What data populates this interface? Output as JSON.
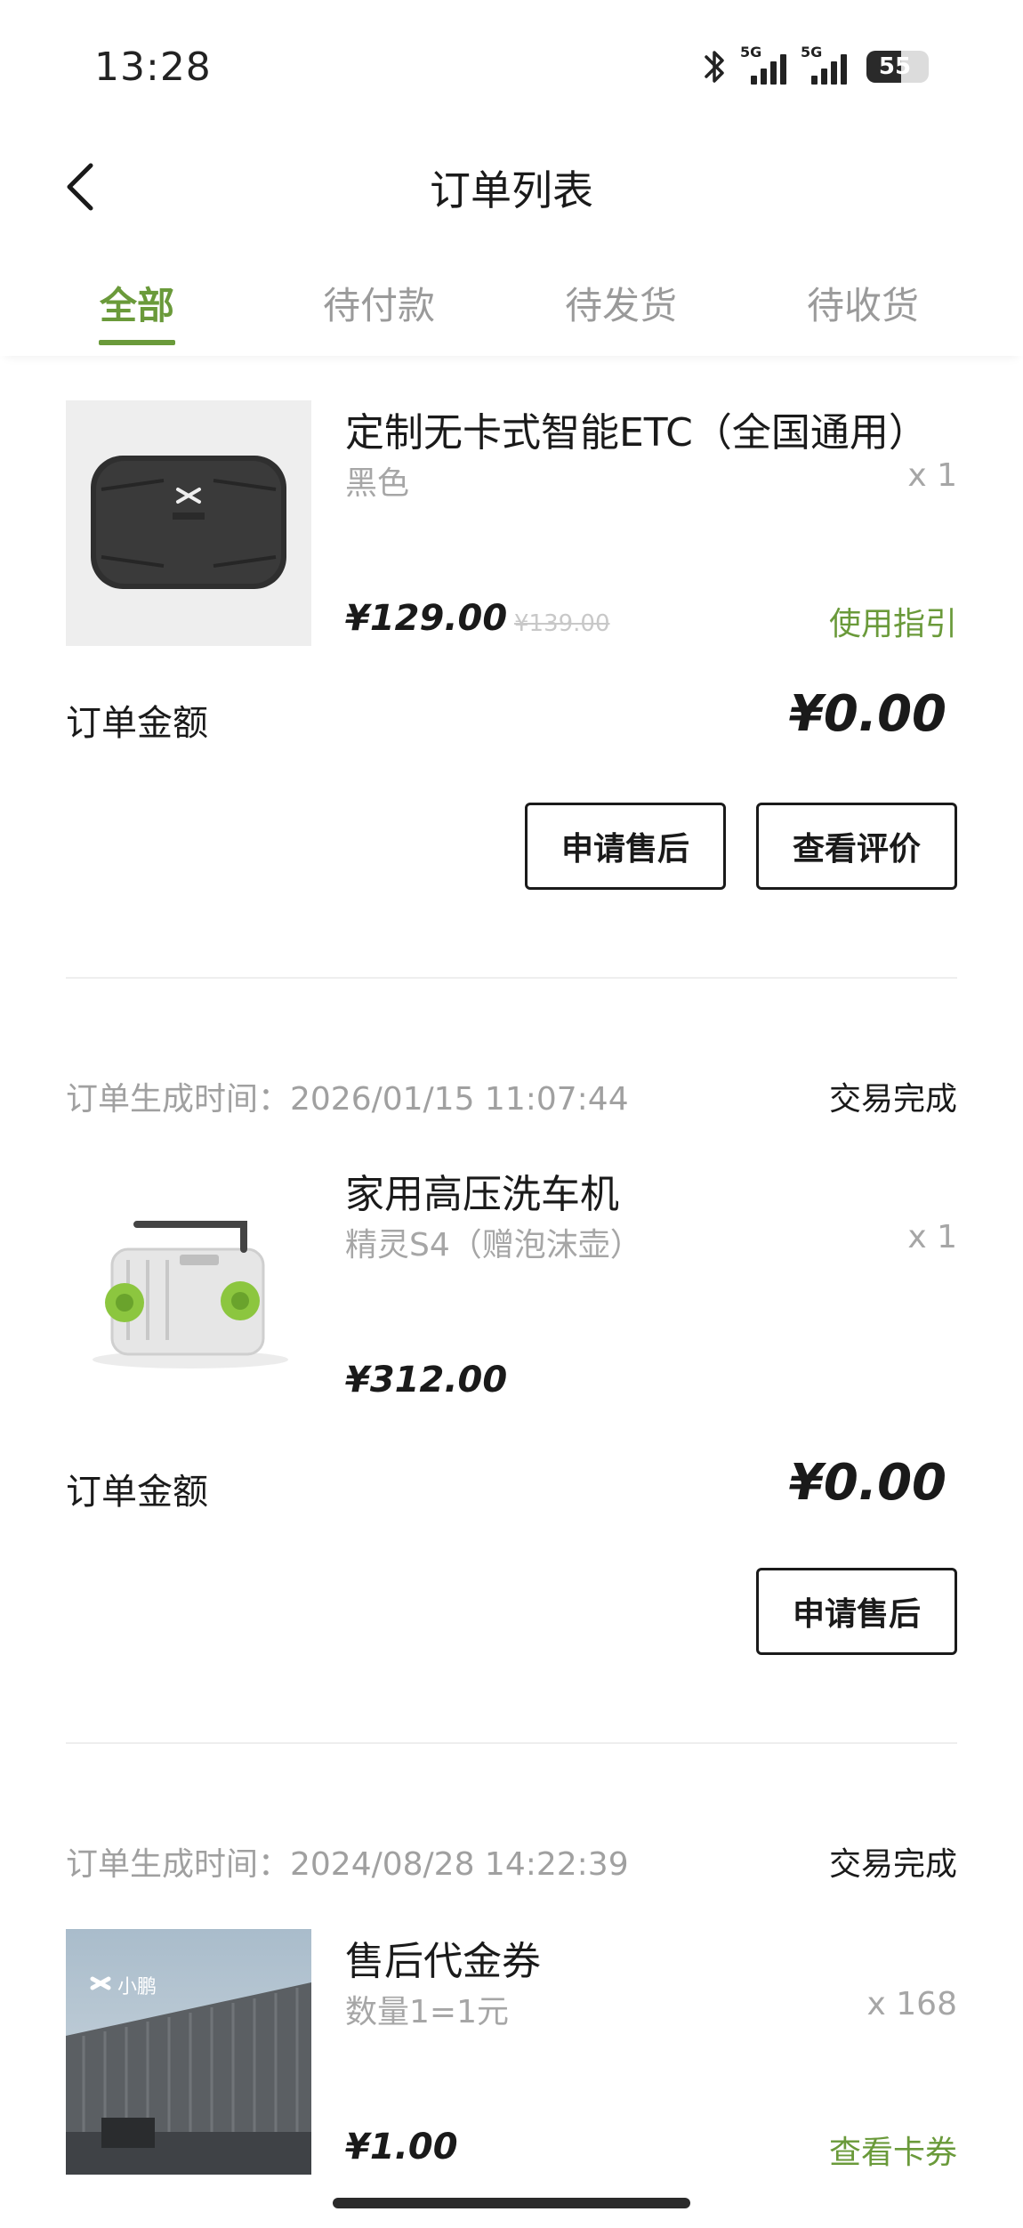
{
  "status_bar": {
    "time": "13:28",
    "network_1": "5G",
    "network_2": "5G",
    "battery": "55",
    "battery_level_percent": 55
  },
  "nav": {
    "title": "订单列表",
    "back_icon": "chevron-left-icon"
  },
  "tabs": [
    {
      "label": "全部",
      "active": true
    },
    {
      "label": "待付款",
      "active": false
    },
    {
      "label": "待发货",
      "active": false
    },
    {
      "label": "待收货",
      "active": false
    }
  ],
  "accent_color": "#6a9a3a",
  "orders": [
    {
      "product": {
        "name": "定制无卡式智能ETC（全国通用）",
        "spec": "黑色",
        "qty": "x 1",
        "price": "¥129.00",
        "original_price": "¥139.00",
        "link": "使用指引"
      },
      "amount_label": "订单金额",
      "amount": "¥0.00",
      "buttons": [
        "申请售后",
        "查看评价"
      ]
    },
    {
      "time_label": "订单生成时间：2026/01/15 11:07:44",
      "status": "交易完成",
      "product": {
        "name": "家用高压洗车机",
        "spec": "精灵S4（赠泡沫壶）",
        "qty": "x 1",
        "price": "¥312.00"
      },
      "amount_label": "订单金额",
      "amount": "¥0.00",
      "buttons": [
        "申请售后"
      ]
    },
    {
      "time_label": "订单生成时间：2024/08/28 14:22:39",
      "status": "交易完成",
      "product": {
        "name": "售后代金券",
        "spec": "数量1=1元",
        "qty": "x 168",
        "price": "¥1.00",
        "link": "查看卡券",
        "image_logo_text": "小鹏"
      }
    }
  ]
}
